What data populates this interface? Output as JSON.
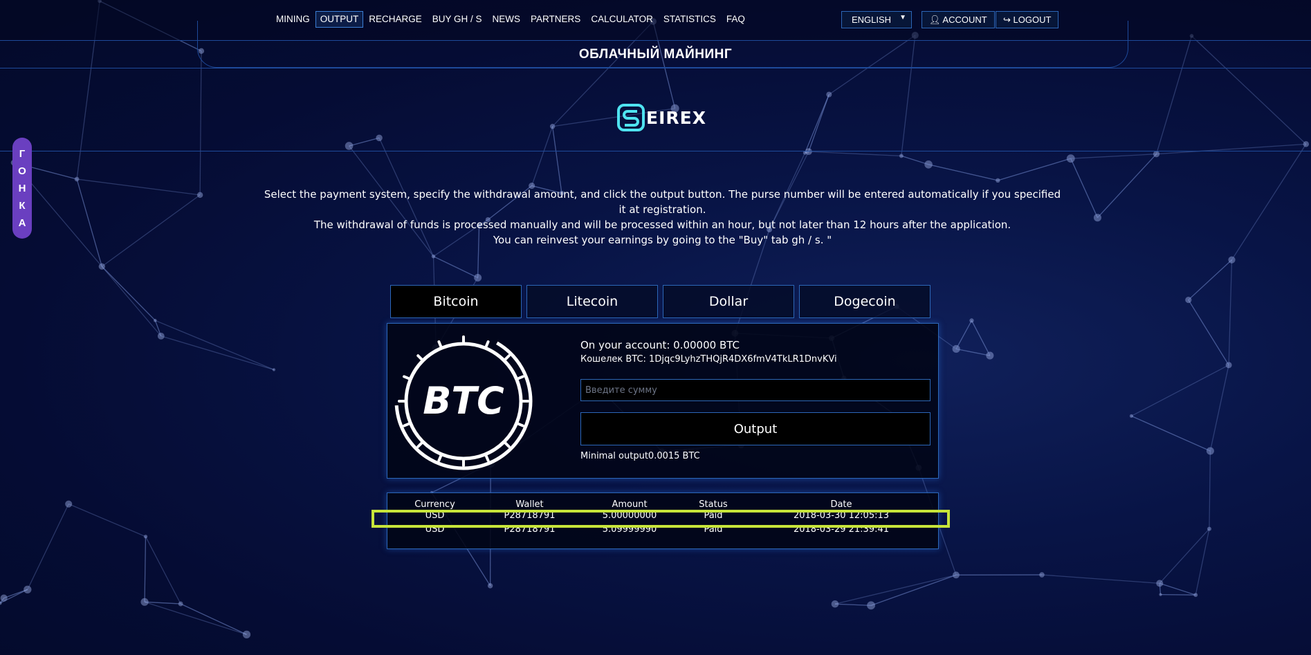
{
  "nav": {
    "items": [
      {
        "label": "MINING"
      },
      {
        "label": "OUTPUT",
        "active": true
      },
      {
        "label": "RECHARGE"
      },
      {
        "label": "BUY GH / S"
      },
      {
        "label": "NEWS"
      },
      {
        "label": "PARTNERS"
      },
      {
        "label": "CALCULATOR"
      },
      {
        "label": "STATISTICS"
      },
      {
        "label": "FAQ"
      }
    ],
    "language": "ENGLISH",
    "account_label": "ACCOUNT",
    "logout_label": "LOGOUT"
  },
  "header": {
    "title": "ОБЛАЧНЫЙ МАЙНИНГ",
    "logo_text": "EIREX"
  },
  "side_tab": {
    "letters": [
      "Г",
      "О",
      "Н",
      "К",
      "А"
    ]
  },
  "description": {
    "lines": [
      "Select the payment system, specify the withdrawal amount, and click the output button. The purse number will be entered automatically if you specified it at registration.",
      "The withdrawal of funds is processed manually and will be processed within an hour, but not later than 12 hours after the application.",
      "You can reinvest your earnings by going to the \"Buy\" tab gh / s. \""
    ]
  },
  "currency_tabs": [
    {
      "label": "Bitcoin",
      "active": true
    },
    {
      "label": "Litecoin"
    },
    {
      "label": "Dollar"
    },
    {
      "label": "Dogecoin"
    }
  ],
  "withdraw": {
    "coin_label": "BTC",
    "balance_text": "On your account: 0.00000 BTC",
    "wallet_text": "Кошелек BTC: 1Djqc9LyhzTHQjR4DX6fmV4TkLR1DnvKVi",
    "amount_placeholder": "Введите сумму",
    "output_label": "Output",
    "minimal_text": "Minimal output0.0015 BTC"
  },
  "history": {
    "columns": [
      "Currency",
      "Wallet",
      "Amount",
      "Status",
      "Date"
    ],
    "rows": [
      [
        "USD",
        "P28718791",
        "5.00000000",
        "Paid",
        "2018-03-30 12:05:13"
      ],
      [
        "USD",
        "P28718791",
        "5.09999990",
        "Paid",
        "2018-03-29 21:39:41"
      ]
    ],
    "highlight_row": 1
  },
  "colors": {
    "accent_border": "#2c67b8",
    "highlight": "#c7e43a",
    "side_tab": "#6a3fc0",
    "logo_cyan": "#4fe3f0"
  }
}
